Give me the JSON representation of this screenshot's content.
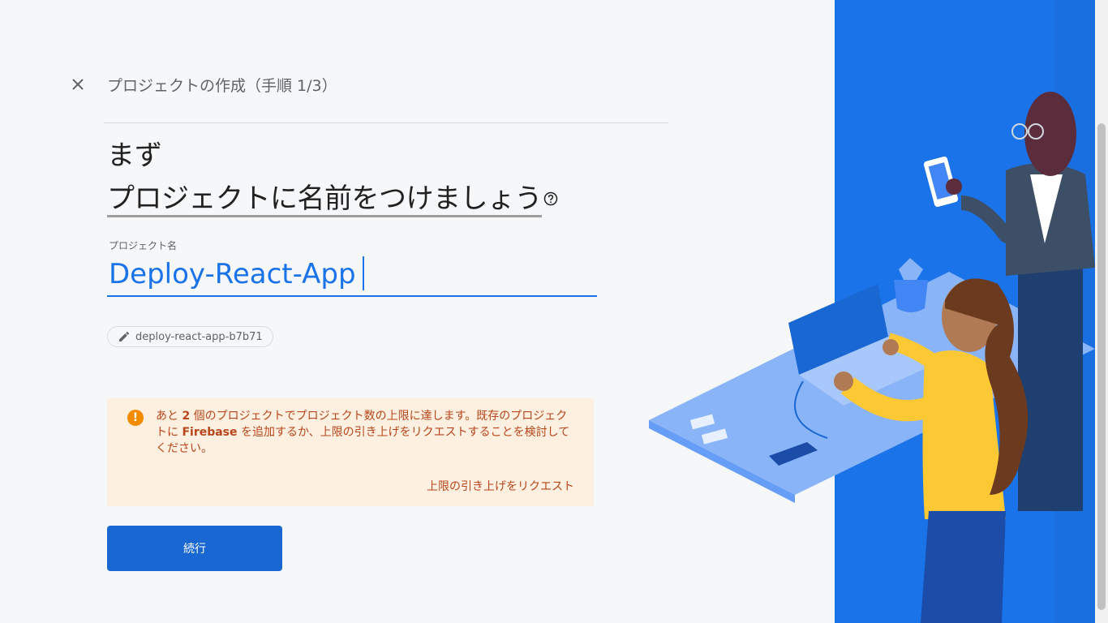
{
  "header": {
    "step_title": "プロジェクトの作成（手順 1/3）"
  },
  "heading": {
    "line1": "まず",
    "line2": "プロジェクトに名前をつけましょう"
  },
  "project_name_field": {
    "label": "プロジェクト名",
    "value": "Deploy-React-App"
  },
  "project_id_chip": {
    "value": "deploy-react-app-b7b71"
  },
  "warning": {
    "icon": "!",
    "text_part1": "あと ",
    "count": "2",
    "text_part2": " 個のプロジェクトでプロジェクト数の上限に達します。既存のプロジェクトに ",
    "product": "Firebase",
    "text_part3": " を追加するか、上限の引き上げをリクエストすることを検討してください。",
    "link": "上限の引き上げをリクエスト"
  },
  "actions": {
    "continue_label": "続行"
  },
  "icons": {
    "close": "close-icon",
    "help": "help-circle-icon",
    "edit": "pencil-icon",
    "warning": "warning-icon"
  },
  "colors": {
    "accent": "#1a73e8",
    "primary_button": "#1967d2",
    "warning_bg": "#fdf0e0",
    "warning_text": "#b8451b",
    "warning_icon": "#f28b00",
    "illustration_bg": "#1a73e8"
  }
}
